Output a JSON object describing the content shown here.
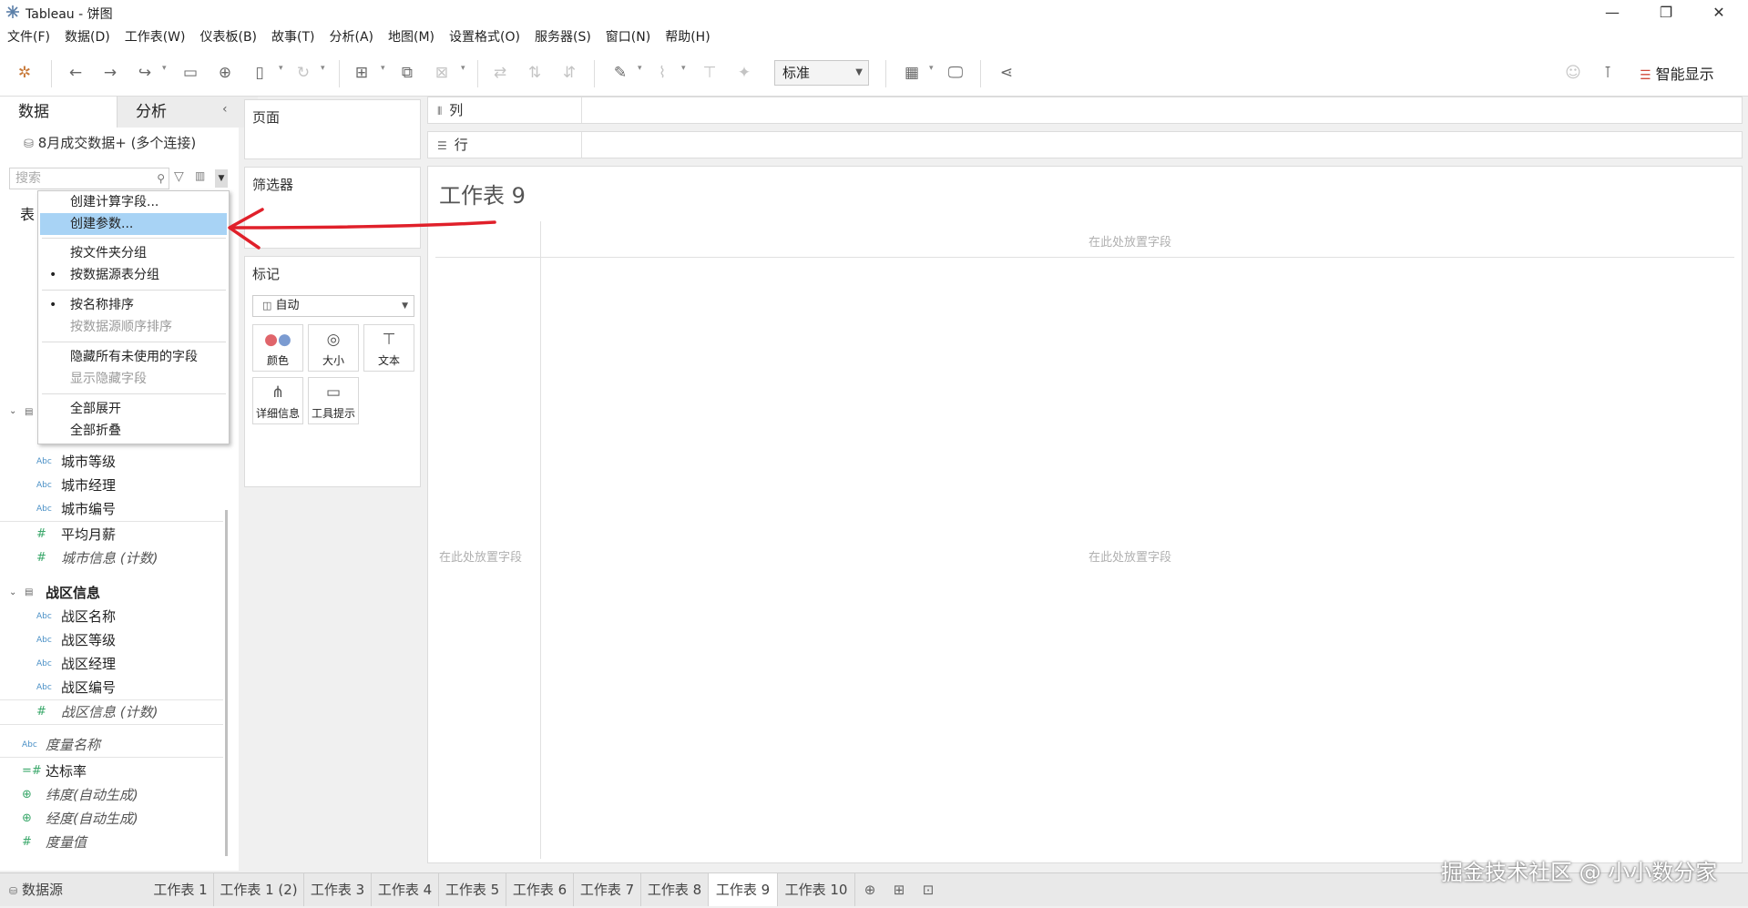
{
  "window": {
    "title": "Tableau - 饼图",
    "min": "—",
    "restore": "❐",
    "close": "✕"
  },
  "menu": [
    "文件(F)",
    "数据(D)",
    "工作表(W)",
    "仪表板(B)",
    "故事(T)",
    "分析(A)",
    "地图(M)",
    "设置格式(O)",
    "服务器(S)",
    "窗口(N)",
    "帮助(H)"
  ],
  "toolbar": {
    "view_size": "标准",
    "smart_show": "智能显示"
  },
  "data_pane": {
    "tab_data": "数据",
    "tab_analysis": "分析",
    "datasource": "8月成交数据+ (多个连接)",
    "search_placeholder": "搜索",
    "tables_label": "表"
  },
  "context_menu": {
    "items": [
      {
        "label": "创建计算字段...",
        "state": "normal"
      },
      {
        "label": "创建参数...",
        "state": "highlighted"
      },
      {
        "label": "按文件夹分组",
        "state": "normal"
      },
      {
        "label": "按数据源表分组",
        "state": "checked"
      },
      {
        "label": "按名称排序",
        "state": "checked"
      },
      {
        "label": "按数据源顺序排序",
        "state": "disabled"
      },
      {
        "label": "隐藏所有未使用的字段",
        "state": "normal"
      },
      {
        "label": "显示隐藏字段",
        "state": "disabled"
      },
      {
        "label": "全部展开",
        "state": "normal"
      },
      {
        "label": "全部折叠",
        "state": "normal"
      }
    ]
  },
  "fields": {
    "city": [
      "城市等级",
      "城市经理",
      "城市编号"
    ],
    "city_measures": [
      "平均月薪",
      "城市信息 (计数)"
    ],
    "group2": "战区信息",
    "zone": [
      "战区名称",
      "战区等级",
      "战区经理",
      "战区编号"
    ],
    "zone_measure": "战区信息 (计数)",
    "measure_names": "度量名称",
    "measures": [
      "达标率",
      "纬度(自动生成)",
      "经度(自动生成)",
      "度量值"
    ],
    "abc": "Abc",
    "hash": "#"
  },
  "shelves": {
    "pages": "页面",
    "filters": "筛选器",
    "marks": "标记",
    "mark_type": "自动",
    "color": "颜色",
    "size": "大小",
    "text": "文本",
    "detail": "详细信息",
    "tooltip": "工具提示",
    "columns": "列",
    "rows": "行"
  },
  "view": {
    "sheet_title": "工作表 9",
    "drop_hint": "在此处放置字段"
  },
  "sheet_tabs": {
    "datasource": "数据源",
    "tabs": [
      "工作表 1",
      "工作表 1 (2)",
      "工作表 3",
      "工作表 4",
      "工作表 5",
      "工作表 6",
      "工作表 7",
      "工作表 8",
      "工作表 9",
      "工作表 10"
    ],
    "active": "工作表 9"
  },
  "watermark": "掘金技术社区 @ 小小数分家",
  "colors": {
    "highlight": "#a8d3f5",
    "arrow": "#e0202a",
    "measure_icon": "#3ba86b",
    "dim_icon": "#4a90c6"
  }
}
